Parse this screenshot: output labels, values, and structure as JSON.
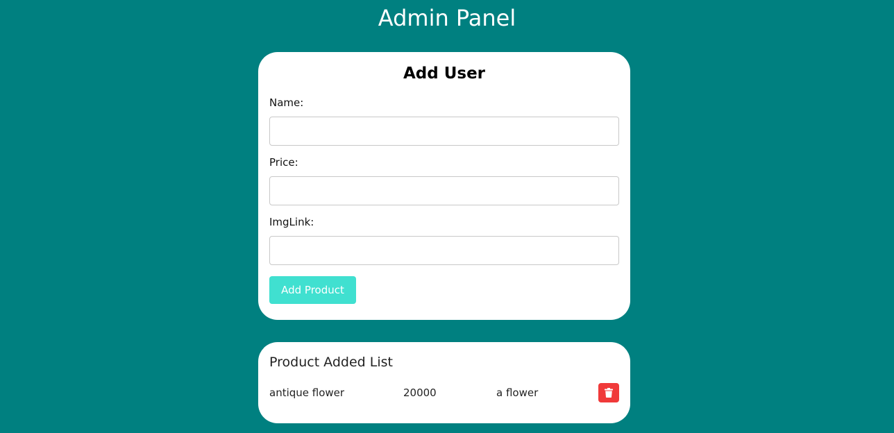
{
  "header": {
    "title": "Admin Panel"
  },
  "form": {
    "heading": "Add User",
    "fields": [
      {
        "label": "Name:",
        "value": "",
        "placeholder": ""
      },
      {
        "label": "Price:",
        "value": "",
        "placeholder": ""
      },
      {
        "label": "ImgLink:",
        "value": "",
        "placeholder": ""
      }
    ],
    "submit_label": "Add Product",
    "submit_color": "#40e0d0"
  },
  "product_list": {
    "heading": "Product Added List",
    "items": [
      {
        "name": "antique flower",
        "price": "20000",
        "img_link": "a flower",
        "delete_icon": "trash-icon"
      }
    ],
    "delete_color": "#f03a3a"
  },
  "theme": {
    "background": "#008080",
    "card": "#ffffff"
  }
}
